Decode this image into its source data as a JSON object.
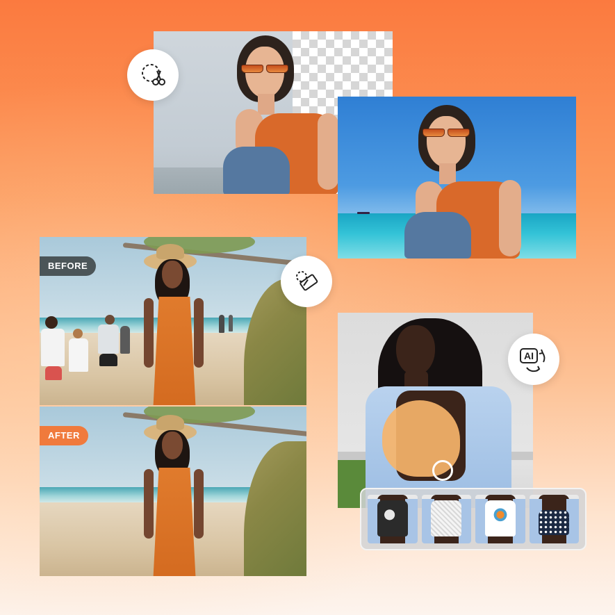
{
  "labels": {
    "before": "BEFORE",
    "after": "AFTER"
  },
  "tools": {
    "cutout_icon": "scissors-cutout-icon",
    "eraser_icon": "eraser-icon",
    "ai_icon": "ai-replace-icon",
    "ai_text": "AI"
  },
  "outfit_swatches": [
    {
      "name": "floral-black-top",
      "color": "#2b2b2b"
    },
    {
      "name": "white-lace-top",
      "color": "#f2f2f2"
    },
    {
      "name": "butterfly-print-top",
      "color": "#ffffff"
    },
    {
      "name": "polka-dot-top",
      "color": "#1c2a44"
    }
  ],
  "colors": {
    "accent_orange": "#f07a3c",
    "before_tag": "#4b5558"
  }
}
